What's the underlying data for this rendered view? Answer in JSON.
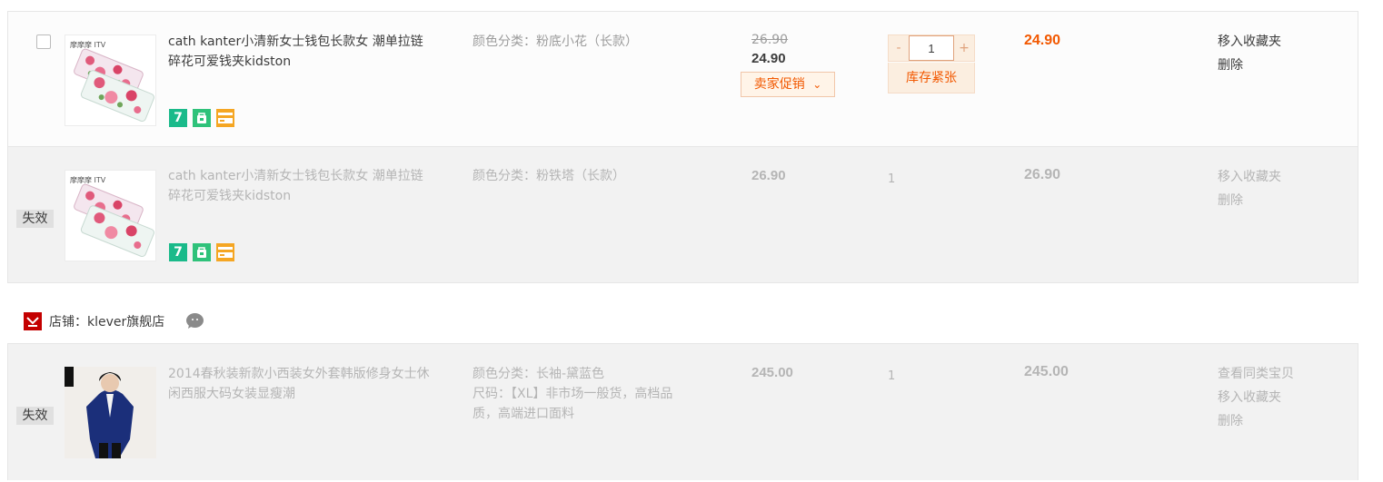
{
  "items": [
    {
      "title": "cath kanter小清新女士钱包长款女 潮单拉链碎花可爱钱夹kidston",
      "sku": "颜色分类：粉底小花（长款）",
      "price_old": "26.90",
      "price_now": "24.90",
      "promo_label": "卖家促销",
      "promo_arrow": "⌄",
      "qty": "1",
      "qty_minus": "-",
      "qty_plus": "+",
      "stock_note": "库存紧张",
      "total": "24.90",
      "ops": [
        "移入收藏夹",
        "删除"
      ],
      "thumb_brand": "摩摩摩 ITV"
    },
    {
      "status": "失效",
      "title": "cath kanter小清新女士钱包长款女 潮单拉链碎花可爱钱夹kidston",
      "sku": "颜色分类：粉铁塔（长款）",
      "price": "26.90",
      "qty": "1",
      "total": "26.90",
      "ops": [
        "移入收藏夹",
        "删除"
      ],
      "thumb_brand": "摩摩摩 ITV"
    },
    {
      "status": "失效",
      "title": "2014春秋装新款小西装女外套韩版修身女士休闲西服大码女装显瘦潮",
      "sku_color": "颜色分类：长袖-黛蓝色",
      "sku_size": "尺码：【XL】非市场一般货，高档品质，高端进口面料",
      "price": "245.00",
      "qty": "1",
      "total": "245.00",
      "ops": [
        "查看同类宝贝",
        "移入收藏夹",
        "删除"
      ]
    }
  ],
  "shop": {
    "label": "店铺：klever旗舰店"
  },
  "service_icons": [
    "seven-day-return-icon",
    "bag-guarantee-icon",
    "card-payment-icon"
  ],
  "colors": {
    "accent": "#f25800",
    "invalid_bg": "#f2f2f2",
    "shop_red": "#c40000"
  }
}
